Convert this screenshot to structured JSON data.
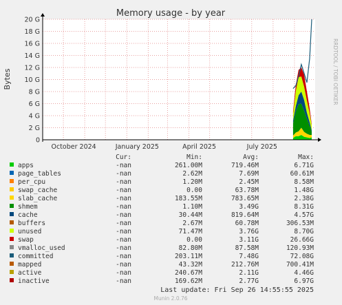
{
  "chart_data": {
    "type": "area",
    "title": "Memory usage - by year",
    "ylabel": "Bytes",
    "side_label": "RRDTOOL / TOBI OETIKER",
    "y_ticks": [
      "0",
      "2 G",
      "4 G",
      "6 G",
      "8 G",
      "10 G",
      "12 G",
      "14 G",
      "16 G",
      "18 G",
      "20 G"
    ],
    "ylim": [
      0,
      20
    ],
    "y_unit": "G",
    "x_ticks": [
      "October 2024",
      "January 2025",
      "April 2025",
      "July 2025"
    ],
    "xlim": [
      "2024-09-01",
      "2025-10-01"
    ],
    "grid": true,
    "columns": {
      "cur": "Cur:",
      "min": "Min:",
      "avg": "Avg:",
      "max": "Max:"
    },
    "series": [
      {
        "name": "apps",
        "color": "#00cc00",
        "cur": "-nan",
        "min": "261.00M",
        "avg": "719.46M",
        "max": "6.71G"
      },
      {
        "name": "page_tables",
        "color": "#0066b3",
        "cur": "-nan",
        "min": "2.62M",
        "avg": "7.69M",
        "max": "60.61M"
      },
      {
        "name": "per_cpu",
        "color": "#ff8000",
        "cur": "-nan",
        "min": "1.20M",
        "avg": "2.45M",
        "max": "8.58M"
      },
      {
        "name": "swap_cache",
        "color": "#ffcc00",
        "cur": "-nan",
        "min": "0.00",
        "avg": "63.78M",
        "max": "1.48G"
      },
      {
        "name": "slab_cache",
        "color": "#ffd700",
        "cur": "-nan",
        "min": "183.55M",
        "avg": "783.65M",
        "max": "2.38G"
      },
      {
        "name": "shmem",
        "color": "#008f00",
        "cur": "-nan",
        "min": "1.10M",
        "avg": "3.49G",
        "max": "8.31G"
      },
      {
        "name": "cache",
        "color": "#00487d",
        "cur": "-nan",
        "min": "30.44M",
        "avg": "819.64M",
        "max": "4.57G"
      },
      {
        "name": "buffers",
        "color": "#b35a00",
        "cur": "-nan",
        "min": "2.67M",
        "avg": "60.78M",
        "max": "306.53M"
      },
      {
        "name": "unused",
        "color": "#ccff00",
        "cur": "-nan",
        "min": "71.47M",
        "avg": "3.76G",
        "max": "8.70G"
      },
      {
        "name": "swap",
        "color": "#cc0000",
        "cur": "-nan",
        "min": "0.00",
        "avg": "3.11G",
        "max": "26.66G"
      },
      {
        "name": "vmalloc_used",
        "color": "#888888",
        "cur": "-nan",
        "min": "82.80M",
        "avg": "87.58M",
        "max": "120.93M"
      },
      {
        "name": "committed",
        "color": "#1a5c7a",
        "cur": "-nan",
        "min": "203.11M",
        "avg": "7.48G",
        "max": "72.08G"
      },
      {
        "name": "mapped",
        "color": "#b85a00",
        "cur": "-nan",
        "min": "43.32M",
        "avg": "212.76M",
        "max": "700.41M"
      },
      {
        "name": "active",
        "color": "#b8a000",
        "cur": "-nan",
        "min": "240.67M",
        "avg": "2.11G",
        "max": "4.46G"
      },
      {
        "name": "inactive",
        "color": "#b00000",
        "cur": "-nan",
        "min": "169.62M",
        "avg": "2.77G",
        "max": "6.97G"
      }
    ],
    "stack": [
      {
        "series": "apps",
        "color": "#00cc00",
        "values": [
          0.3,
          0.6,
          0.6,
          0.8,
          0.5,
          0.4,
          0.3,
          0.4
        ]
      },
      {
        "series": "slab_cache",
        "color": "#ffd700",
        "values": [
          0.4,
          0.6,
          0.8,
          1.2,
          0.8,
          0.6,
          0.5,
          0.4
        ]
      },
      {
        "series": "shmem",
        "color": "#008f00",
        "values": [
          2.0,
          3.5,
          4.5,
          4.0,
          3.5,
          2.5,
          1.5,
          0.6
        ]
      },
      {
        "series": "cache",
        "color": "#00487d",
        "values": [
          0.5,
          0.9,
          1.5,
          2.0,
          1.8,
          1.0,
          0.6,
          0.2
        ]
      },
      {
        "series": "unused",
        "color": "#ccff00",
        "values": [
          1.0,
          2.5,
          3.0,
          2.5,
          2.2,
          2.0,
          1.5,
          0.8
        ]
      },
      {
        "series": "swap",
        "color": "#cc0000",
        "values": [
          0.5,
          1.0,
          1.2,
          1.5,
          2.0,
          1.5,
          0.8,
          0.2
        ]
      }
    ],
    "stack_dates": [
      "2025-08-30",
      "2025-09-03",
      "2025-09-07",
      "2025-09-11",
      "2025-09-15",
      "2025-09-19",
      "2025-09-23",
      "2025-09-26"
    ],
    "committed_line": {
      "values": [
        8.5,
        9.0,
        10.5,
        12.5,
        11.0,
        9.5,
        13.5,
        20.0
      ]
    }
  },
  "footer": {
    "last_update": "Last update: Fri Sep 26 14:55:55 2025",
    "version": "Munin 2.0.76"
  }
}
